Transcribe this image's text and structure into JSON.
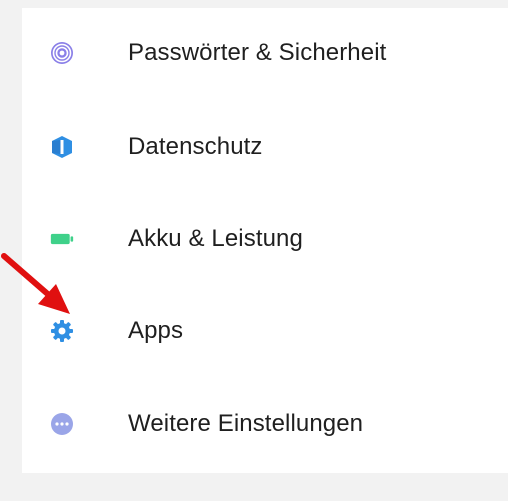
{
  "settings": {
    "items": [
      {
        "label": "Passwörter & Sicherheit",
        "icon": "fingerprint-icon",
        "color": "#8a7fe8"
      },
      {
        "label": "Datenschutz",
        "icon": "privacy-shield-icon",
        "color": "#2f8fe3"
      },
      {
        "label": "Akku & Leistung",
        "icon": "battery-icon",
        "color": "#3fd18a"
      },
      {
        "label": "Apps",
        "icon": "gear-icon",
        "color": "#2f8fe3"
      },
      {
        "label": "Weitere Einstellungen",
        "icon": "more-icon",
        "color": "#9aa5e8"
      }
    ]
  },
  "annotation": {
    "arrow_color": "#e01010"
  }
}
